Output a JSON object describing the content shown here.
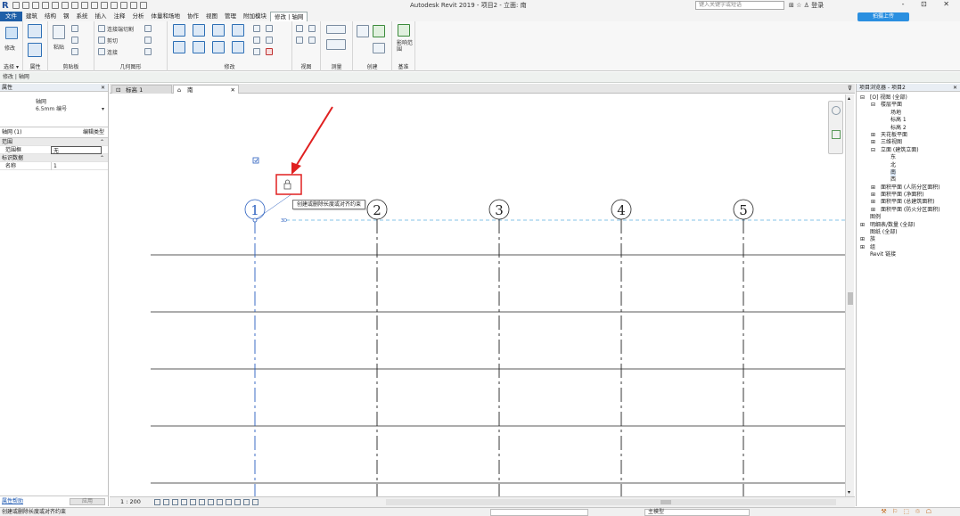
{
  "app": {
    "logo": "R",
    "window_title": "Autodesk Revit 2019 - 项目2 - 立面: 南",
    "search_placeholder": "键入关键字或短语",
    "title_icons": "⊞ ☆ ♙ 登录",
    "window_controls": "- ⊡ ✕"
  },
  "menu": {
    "tabs": [
      "文件",
      "建筑",
      "结构",
      "钢",
      "系统",
      "插入",
      "注释",
      "分析",
      "体量和场地",
      "协作",
      "视图",
      "管理",
      "附加模块",
      "修改 | 轴网"
    ],
    "active_index": 13,
    "cloud_button": "拍摄上传"
  },
  "ribbon": {
    "panels": [
      {
        "name": "选择 ▾",
        "tool": "修改"
      },
      {
        "name": "属性"
      },
      {
        "name": "剪贴板",
        "tool": "粘贴"
      },
      {
        "name": "几何图形",
        "items": [
          "连接端切割",
          "剪切",
          "连接"
        ]
      },
      {
        "name": "修改"
      },
      {
        "name": "视图"
      },
      {
        "name": "测量"
      },
      {
        "name": "创建"
      },
      {
        "name": "基准",
        "tool": "影响范围"
      }
    ]
  },
  "optionbar": {
    "text": "修改 | 轴网"
  },
  "properties": {
    "header": "属性",
    "close": "✕",
    "type_name": "轴网",
    "type_sub": "6.5mm 编号",
    "type_arrow": "▾",
    "instance_label": "轴网 (1)",
    "edit_type": "编辑类型",
    "categories": [
      {
        "name": "范围",
        "toggle": "⌃",
        "rows": [
          {
            "key": "范围框",
            "value": "无",
            "boxed": true
          }
        ]
      },
      {
        "name": "标识数据",
        "toggle": "⌃",
        "rows": [
          {
            "key": "名称",
            "value": "1",
            "boxed": false
          }
        ]
      }
    ],
    "help": "属性帮助",
    "apply": "应用"
  },
  "view_tabs": [
    {
      "label": "标高 1",
      "icon": "⊡",
      "active": false
    },
    {
      "label": "南",
      "icon": "⌂",
      "active": true
    }
  ],
  "view_tabs_more": "⊽",
  "canvas": {
    "tooltip": "创建或删除长度或对齐约束",
    "grids": [
      {
        "label": "1",
        "selected": true
      },
      {
        "label": "2",
        "selected": false
      },
      {
        "label": "3",
        "selected": false
      },
      {
        "label": "4",
        "selected": false
      },
      {
        "label": "5",
        "selected": false
      }
    ],
    "lock_glyph": "🔒",
    "checkbox_glyph": "☑",
    "bubble_3d": "3D"
  },
  "view_control": {
    "scale": "1 : 200"
  },
  "browser": {
    "header": "项目浏览器 - 项目2",
    "close": "✕",
    "tree": [
      {
        "label": "[O] 视图 (全部)",
        "level": 0,
        "pm": "⊟"
      },
      {
        "label": "楼层平面",
        "level": 1,
        "pm": "⊟"
      },
      {
        "label": "场地",
        "level": 2,
        "pm": ""
      },
      {
        "label": "标高 1",
        "level": 2,
        "pm": ""
      },
      {
        "label": "标高 2",
        "level": 2,
        "pm": ""
      },
      {
        "label": "天花板平面",
        "level": 1,
        "pm": "⊞"
      },
      {
        "label": "三维视图",
        "level": 1,
        "pm": "⊞"
      },
      {
        "label": "立面 (建筑立面)",
        "level": 1,
        "pm": "⊟"
      },
      {
        "label": "东",
        "level": 2,
        "pm": ""
      },
      {
        "label": "北",
        "level": 2,
        "pm": ""
      },
      {
        "label": "南",
        "level": 2,
        "pm": "",
        "selected": true
      },
      {
        "label": "西",
        "level": 2,
        "pm": ""
      },
      {
        "label": "面积平面 (人防分区面积)",
        "level": 1,
        "pm": "⊞"
      },
      {
        "label": "面积平面 (净面积)",
        "level": 1,
        "pm": "⊞"
      },
      {
        "label": "面积平面 (总建筑面积)",
        "level": 1,
        "pm": "⊞"
      },
      {
        "label": "面积平面 (防火分区面积)",
        "level": 1,
        "pm": "⊞"
      },
      {
        "label": "图例",
        "level": 0,
        "pm": ""
      },
      {
        "label": "明细表/数量 (全部)",
        "level": 0,
        "pm": "⊞"
      },
      {
        "label": "图纸 (全部)",
        "level": 0,
        "pm": ""
      },
      {
        "label": "族",
        "level": 0,
        "pm": "⊞"
      },
      {
        "label": "组",
        "level": 0,
        "pm": "⊞"
      },
      {
        "label": "Revit 链接",
        "level": 0,
        "pm": ""
      }
    ]
  },
  "status": {
    "message": "创建或删除长度或对齐约束",
    "main_model": "主模型",
    "icons": "⚒ ⚐ ⬚ ♲ ☖"
  },
  "colors": {
    "accent": "#1f5fa8",
    "selection": "#2a5fbf",
    "arrow": "#e02020",
    "level_dash": "#5fb0e0"
  }
}
